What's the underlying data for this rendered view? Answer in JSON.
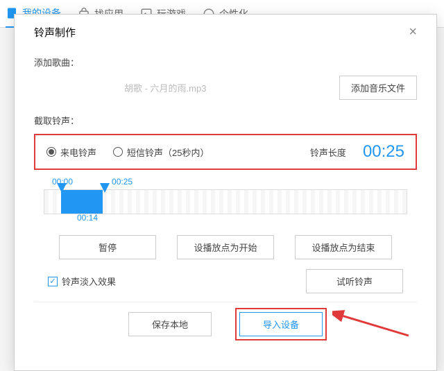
{
  "topbar": {
    "tabs": [
      "我的设备",
      "找应用",
      "玩游戏",
      "个性化"
    ]
  },
  "modal": {
    "title": "铃声制作",
    "add_label": "添加歌曲：",
    "filename": "胡歌 - 六月的雨.mp3",
    "add_btn": "添加音乐文件",
    "cut_label": "截取铃声：",
    "radio_call": "来电铃声",
    "radio_sms": "短信铃声（25秒内）",
    "length_label": "铃声长度",
    "length_val": "00:25",
    "tl_start": "00:00",
    "tl_end": "00:25",
    "tl_play": "00:14",
    "btn_pause": "暂停",
    "btn_set_start": "设播放点为开始",
    "btn_set_end": "设播放点为结束",
    "check_fade": "铃声淡入效果",
    "btn_preview": "试听铃声",
    "btn_save": "保存本地",
    "btn_import": "导入设备"
  }
}
